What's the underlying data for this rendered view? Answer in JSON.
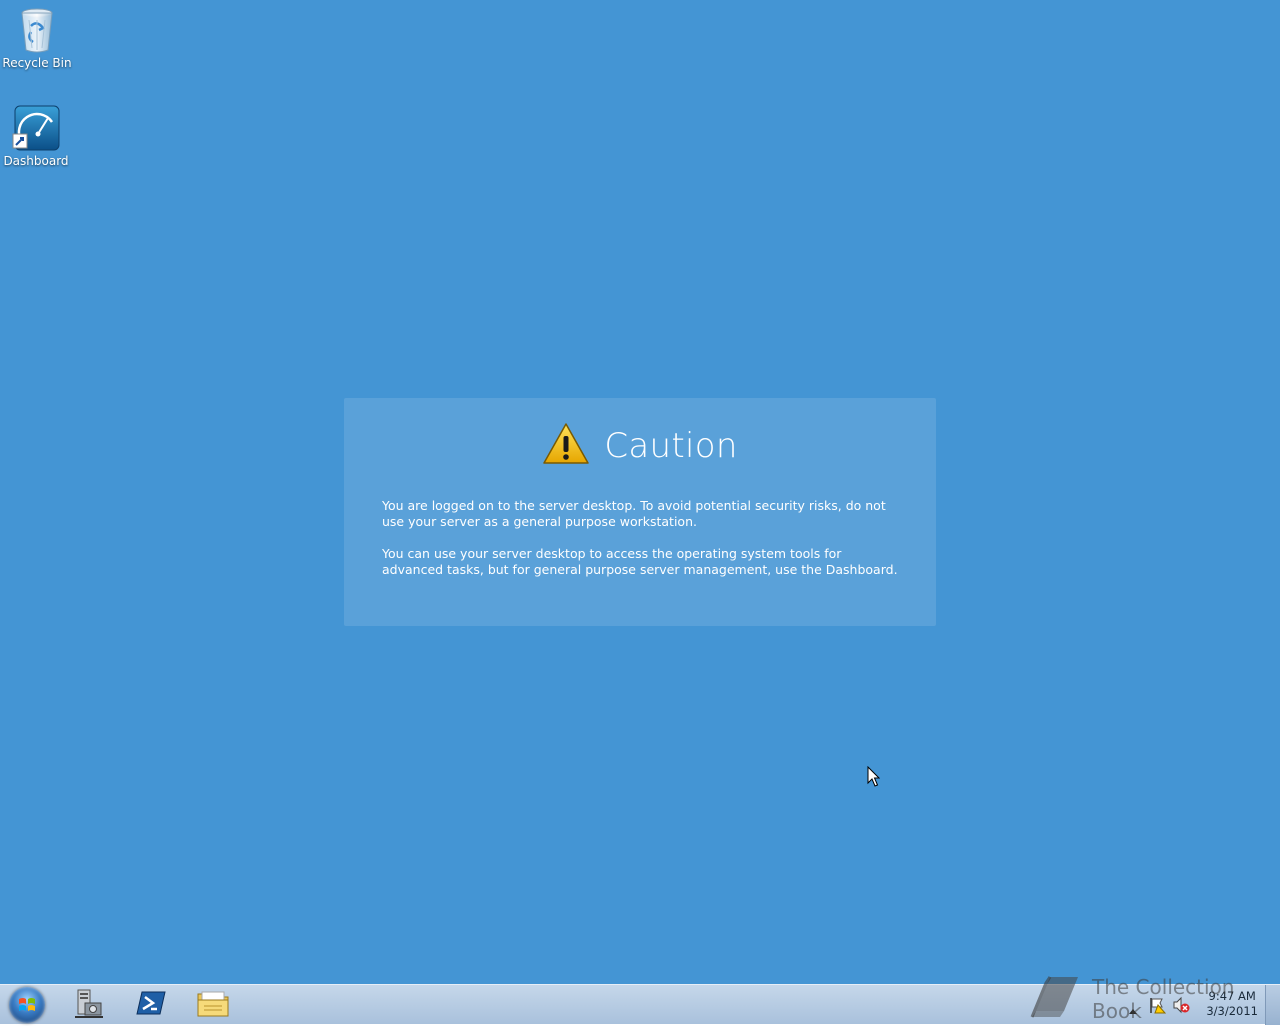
{
  "desktop": {
    "background_color": "#4495d4",
    "icons": [
      {
        "label": "Recycle Bin",
        "icon": "recycle-bin-icon"
      },
      {
        "label": "Dashboard",
        "icon": "dashboard-icon"
      }
    ]
  },
  "caution": {
    "title": "Caution",
    "icon": "warning-icon",
    "paragraphs": [
      "You are logged on to the server desktop. To avoid potential security risks, do not use your server as a general purpose workstation.",
      "You can use your server desktop to access the operating system tools for advanced tasks, but for general purpose server management, use the Dashboard."
    ]
  },
  "taskbar": {
    "pinned": [
      {
        "icon": "start-orb-icon"
      },
      {
        "icon": "server-manager-icon"
      },
      {
        "icon": "powershell-icon"
      },
      {
        "icon": "file-explorer-icon"
      }
    ],
    "tray": {
      "icons": [
        "show-hidden-icons-arrow",
        "action-center-flag-icon",
        "speaker-muted-icon"
      ],
      "time": "9:47 AM",
      "date": "3/3/2011"
    }
  },
  "watermark": {
    "text": "The Collection Book",
    "icon": "book-icon"
  }
}
